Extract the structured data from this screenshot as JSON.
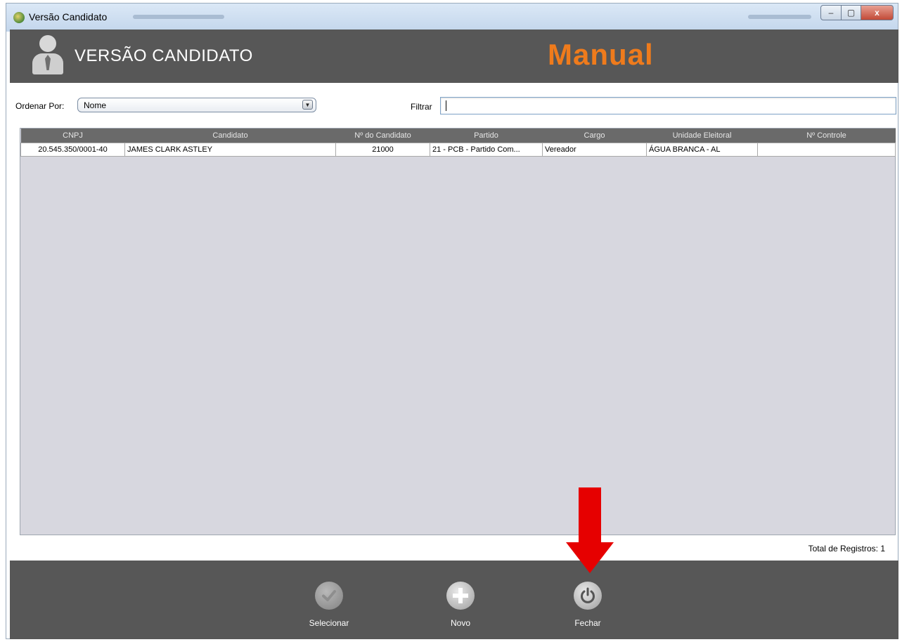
{
  "window": {
    "title": "Versão Candidato",
    "buttons": {
      "minimize": "‒",
      "maximize": "▢",
      "close": "x"
    }
  },
  "header": {
    "title": "VERSÃO CANDIDATO",
    "mode": "Manual",
    "icon": "candidate-person-icon"
  },
  "toolbar": {
    "sort_label": "Ordenar Por:",
    "sort_value": "Nome",
    "sort_arrow": "▼",
    "filter_label": "Filtrar",
    "filter_value": ""
  },
  "table": {
    "columns": [
      "CNPJ",
      "Candidato",
      "Nº do Candidato",
      "Partido",
      "Cargo",
      "Unidade Eleitoral",
      "Nº Controle"
    ],
    "rows": [
      [
        "20.545.350/0001-40",
        "JAMES CLARK ASTLEY",
        "21000",
        "21 - PCB - Partido Com...",
        "Vereador",
        "ÁGUA BRANCA - AL",
        ""
      ]
    ]
  },
  "status": {
    "total_label": "Total de Registros: 1"
  },
  "footer": {
    "buttons": [
      {
        "label": "Selecionar",
        "icon": "check-icon",
        "enabled": false
      },
      {
        "label": "Novo",
        "icon": "plus-icon",
        "enabled": true
      },
      {
        "label": "Fechar",
        "icon": "power-icon",
        "enabled": true
      }
    ]
  },
  "colors": {
    "header_bg": "#575757",
    "mode_text": "#ef7b1c",
    "table_bg": "#d7d7df",
    "annotation_arrow": "#e60000"
  }
}
